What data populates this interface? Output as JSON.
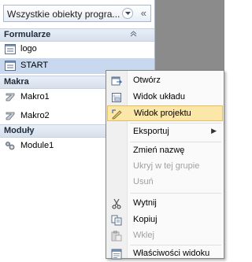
{
  "nav": {
    "header_title": "Wszystkie obiekty progra...",
    "collapse_symbol": "«",
    "groups": [
      {
        "label": "Formularze",
        "chevron": "≈",
        "items": [
          {
            "label": "logo",
            "icon": "form-icon"
          },
          {
            "label": "START",
            "icon": "form-icon"
          }
        ]
      },
      {
        "label": "Makra",
        "chevron": "",
        "items": [
          {
            "label": "Makro1",
            "icon": "macro-icon"
          },
          {
            "label": "Makro2",
            "icon": "macro-icon"
          }
        ]
      },
      {
        "label": "Moduły",
        "chevron": "",
        "items": [
          {
            "label": "Module1",
            "icon": "module-icon"
          }
        ]
      }
    ]
  },
  "menu": {
    "items": [
      {
        "label": "Otwórz",
        "icon": "open-form-icon",
        "state": "normal"
      },
      {
        "label": "Widok układu",
        "icon": "layout-view-icon",
        "state": "normal"
      },
      {
        "label": "Widok projektu",
        "icon": "design-view-icon",
        "state": "highlighted"
      },
      {
        "label": "Eksportuj",
        "icon": "",
        "state": "submenu",
        "arrow": "▶"
      },
      {
        "label": "Zmień nazwę",
        "icon": "",
        "state": "normal"
      },
      {
        "label": "Ukryj w tej grupie",
        "icon": "",
        "state": "disabled"
      },
      {
        "label": "Usuń",
        "icon": "",
        "state": "disabled"
      },
      {
        "label": "Wytnij",
        "icon": "scissors-icon",
        "state": "normal"
      },
      {
        "label": "Kopiuj",
        "icon": "copy-icon",
        "state": "normal"
      },
      {
        "label": "Wklej",
        "icon": "paste-icon",
        "state": "disabled"
      },
      {
        "label": "Właściwości widoku",
        "icon": "properties-icon",
        "state": "normal"
      }
    ]
  },
  "colors": {
    "highlight": "#fce7a8",
    "selected_row": "#c7d8ef",
    "workspace": "#8b8b8b"
  }
}
